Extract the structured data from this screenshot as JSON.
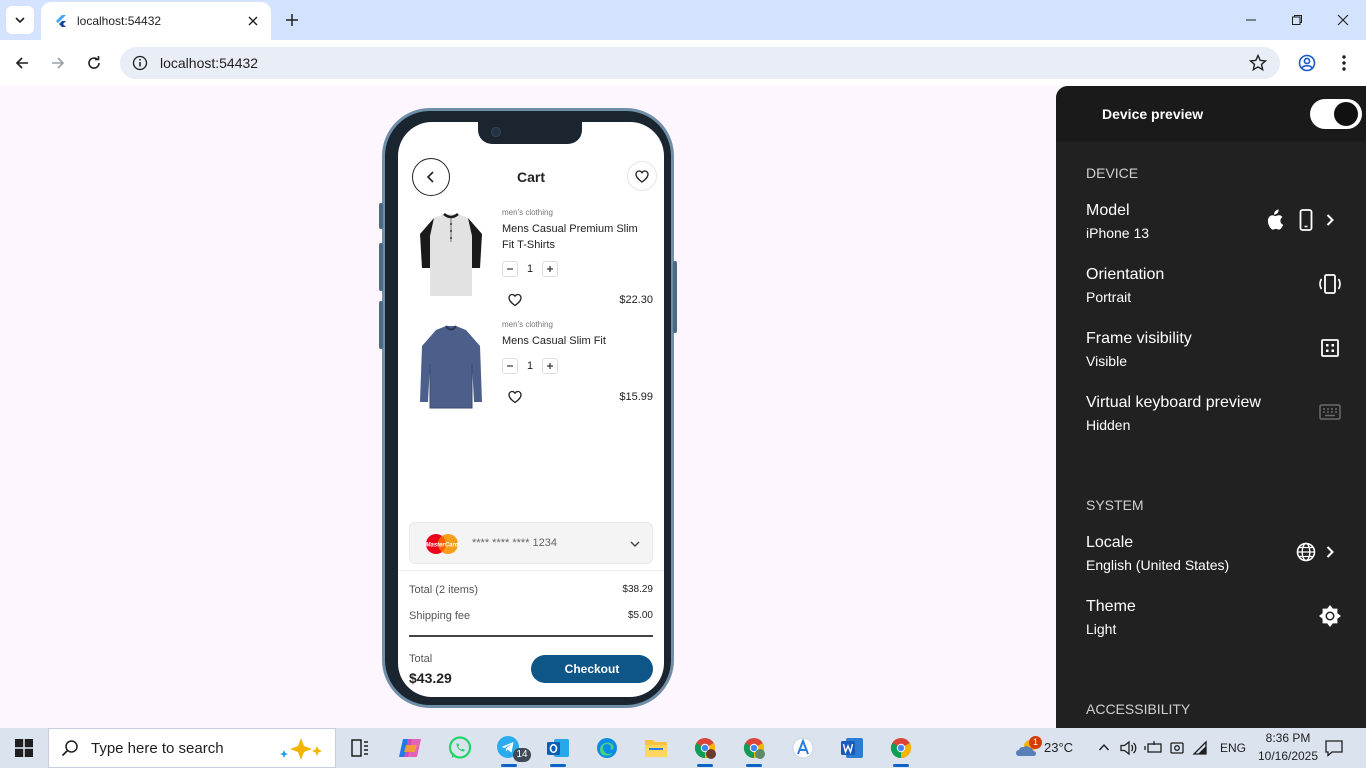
{
  "browser": {
    "tab_title": "localhost:54432",
    "url": "localhost:54432"
  },
  "app": {
    "title": "Cart",
    "items": [
      {
        "category": "men's clothing",
        "name": "Mens Casual Premium Slim Fit T-Shirts",
        "qty": "1",
        "price": "$22.30"
      },
      {
        "category": "men's clothing",
        "name": "Mens Casual Slim Fit",
        "qty": "1",
        "price": "$15.99"
      }
    ],
    "payment": {
      "card_brand": "MasterCard",
      "card_number": "**** **** **** 1234"
    },
    "summary": {
      "total_items_label": "Total (2 items)",
      "total_items_value": "$38.29",
      "shipping_label": "Shipping fee",
      "shipping_value": "$5.00",
      "total_label": "Total",
      "total_value": "$43.29",
      "checkout_label": "Checkout"
    }
  },
  "device_preview": {
    "title": "Device preview",
    "device_section": "DEVICE",
    "system_section": "SYSTEM",
    "accessibility_section": "ACCESSIBILITY",
    "rows": {
      "model": {
        "label": "Model",
        "value": "iPhone 13"
      },
      "orientation": {
        "label": "Orientation",
        "value": "Portrait"
      },
      "frame": {
        "label": "Frame visibility",
        "value": "Visible"
      },
      "keyboard": {
        "label": "Virtual keyboard preview",
        "value": "Hidden"
      },
      "locale": {
        "label": "Locale",
        "value": "English (United States)"
      },
      "theme": {
        "label": "Theme",
        "value": "Light"
      }
    }
  },
  "taskbar": {
    "search_placeholder": "Type here to search",
    "telegram_badge": "14",
    "weather": "23°C",
    "weather_badge": "1",
    "lang": "ENG",
    "time": "8:36 PM",
    "date": "10/16/2025"
  },
  "colors": {
    "accent": "#0e5687",
    "panel_bg": "#212121",
    "page_bg": "#fdf6ff"
  }
}
